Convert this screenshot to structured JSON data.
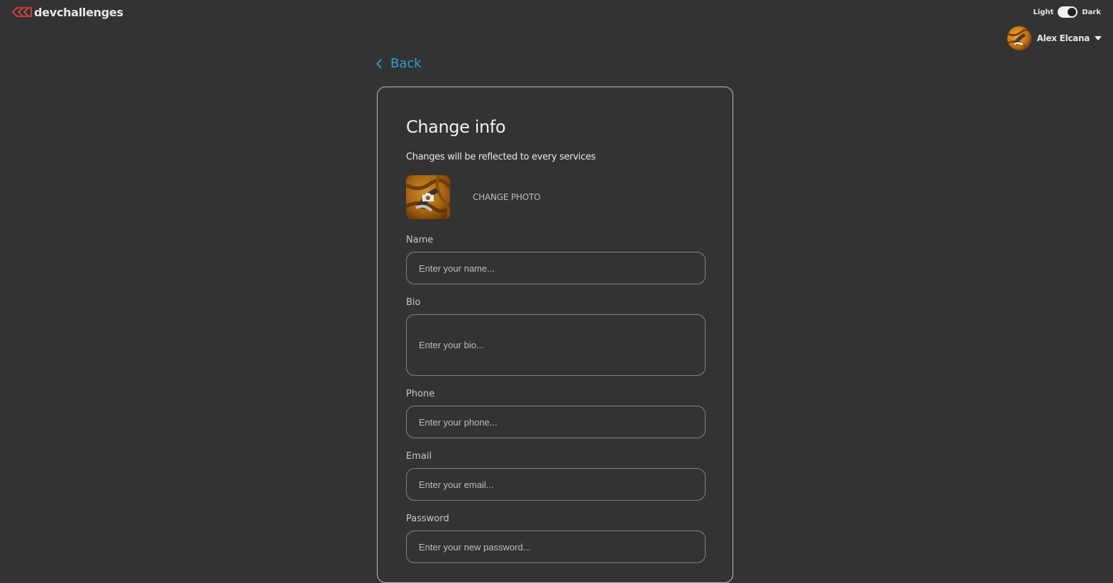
{
  "header": {
    "logo_text": "devchallenges",
    "theme_light_label": "Light",
    "theme_dark_label": "Dark",
    "user_name": "Alex Elcana"
  },
  "nav": {
    "back_label": "Back"
  },
  "form": {
    "title": "Change info",
    "subtitle": "Changes will be reflected to every services",
    "change_photo_label": "CHANGE PHOTO",
    "fields": {
      "name": {
        "label": "Name",
        "placeholder": "Enter your name..."
      },
      "bio": {
        "label": "Bio",
        "placeholder": "Enter your bio..."
      },
      "phone": {
        "label": "Phone",
        "placeholder": "Enter your phone..."
      },
      "email": {
        "label": "Email",
        "placeholder": "Enter your email..."
      },
      "password": {
        "label": "Password",
        "placeholder": "Enter your new password..."
      }
    }
  },
  "colors": {
    "background": "#333333",
    "accent_link": "#2d9cdb",
    "logo_red": "#e2433b",
    "card_border": "#bdbdbd",
    "input_border": "#828282"
  },
  "icons": {
    "logo": "devchallenges-logo-icon",
    "back": "chevron-left-icon",
    "caret": "caret-down-icon",
    "camera": "camera-icon"
  }
}
